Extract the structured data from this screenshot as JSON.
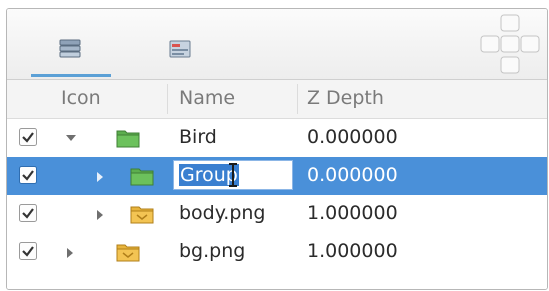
{
  "tabs": [
    {
      "icon": "layers-icon",
      "active": true
    },
    {
      "icon": "params-icon",
      "active": false
    }
  ],
  "columns": {
    "icon": "Icon",
    "name": "Name",
    "zdepth": "Z Depth"
  },
  "rows": [
    {
      "checked": true,
      "expanded": true,
      "depth_level": 0,
      "icon": "group-folder-icon",
      "name": "Bird",
      "zdepth": "0.000000",
      "selected": false
    },
    {
      "checked": true,
      "expanded": false,
      "depth_level": 1,
      "icon": "group-folder-icon",
      "name": "Group",
      "zdepth": "0.000000",
      "selected": true,
      "editing": true
    },
    {
      "checked": true,
      "expanded": false,
      "depth_level": 1,
      "icon": "image-layer-icon",
      "name": "body.png",
      "zdepth": "1.000000",
      "selected": false
    },
    {
      "checked": true,
      "expanded": false,
      "depth_level": 0,
      "icon": "image-layer-icon",
      "name": "bg.png",
      "zdepth": "1.000000",
      "selected": false
    }
  ],
  "colors": {
    "selection": "#4a90d9",
    "tab_indicator": "#5ba0d6",
    "group_folder": "#5cae4e",
    "image_layer": "#e8b43c"
  }
}
